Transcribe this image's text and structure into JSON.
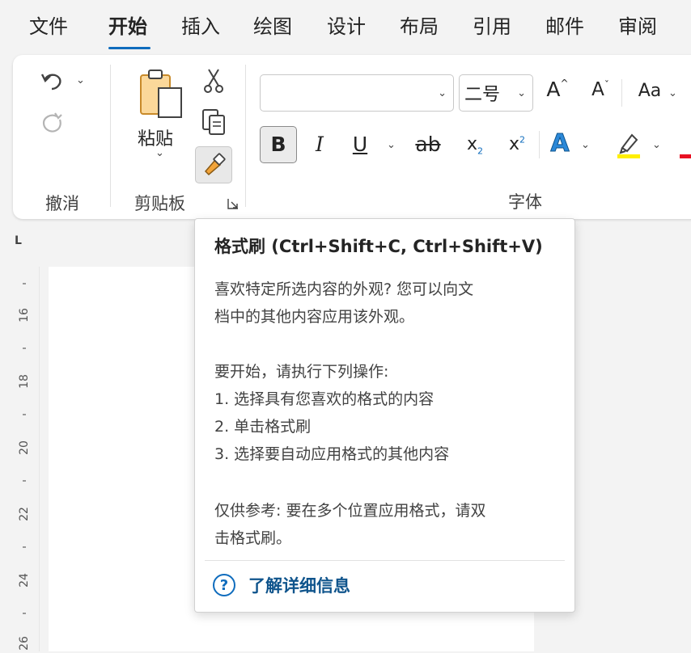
{
  "tabs": [
    {
      "label": "文件"
    },
    {
      "label": "开始"
    },
    {
      "label": "插入"
    },
    {
      "label": "绘图"
    },
    {
      "label": "设计"
    },
    {
      "label": "布局"
    },
    {
      "label": "引用"
    },
    {
      "label": "邮件"
    },
    {
      "label": "审阅"
    }
  ],
  "active_tab": "开始",
  "ribbon": {
    "undo_group_label": "撤消",
    "clipboard_group_label": "剪贴板",
    "paste_label": "粘贴",
    "font_group_label": "字体",
    "font_name_value": "",
    "font_size_value": "二号",
    "grow_font": "A",
    "shrink_font": "A",
    "change_case": "Aa",
    "bold": "B",
    "italic": "I",
    "underline": "U",
    "strike": "ab",
    "subscript_base": "x",
    "subscript_sub": "2",
    "superscript_base": "x",
    "superscript_sup": "2",
    "text_effects": "A"
  },
  "colors": {
    "accent": "#0f6cbd",
    "highlight": "#ffef00",
    "font_color": "#e81123",
    "format_painter_active_bg": "#e8e8e8"
  },
  "ruler": {
    "corner": "L",
    "numbers": [
      "16",
      "18",
      "20",
      "22",
      "24",
      "26"
    ]
  },
  "tooltip": {
    "title": "格式刷 (Ctrl+Shift+C, Ctrl+Shift+V)",
    "para1_line1": "喜欢特定所选内容的外观? 您可以向文",
    "para1_line2": "档中的其他内容应用该外观。",
    "para2_intro": "要开始，请执行下列操作:",
    "step1": "1. 选择具有您喜欢的格式的内容",
    "step2": "2. 单击格式刷",
    "step3": "3. 选择要自动应用格式的其他内容",
    "para3_line1": "仅供参考: 要在多个位置应用格式，请双",
    "para3_line2": "击格式刷。",
    "help_link": "了解详细信息"
  }
}
